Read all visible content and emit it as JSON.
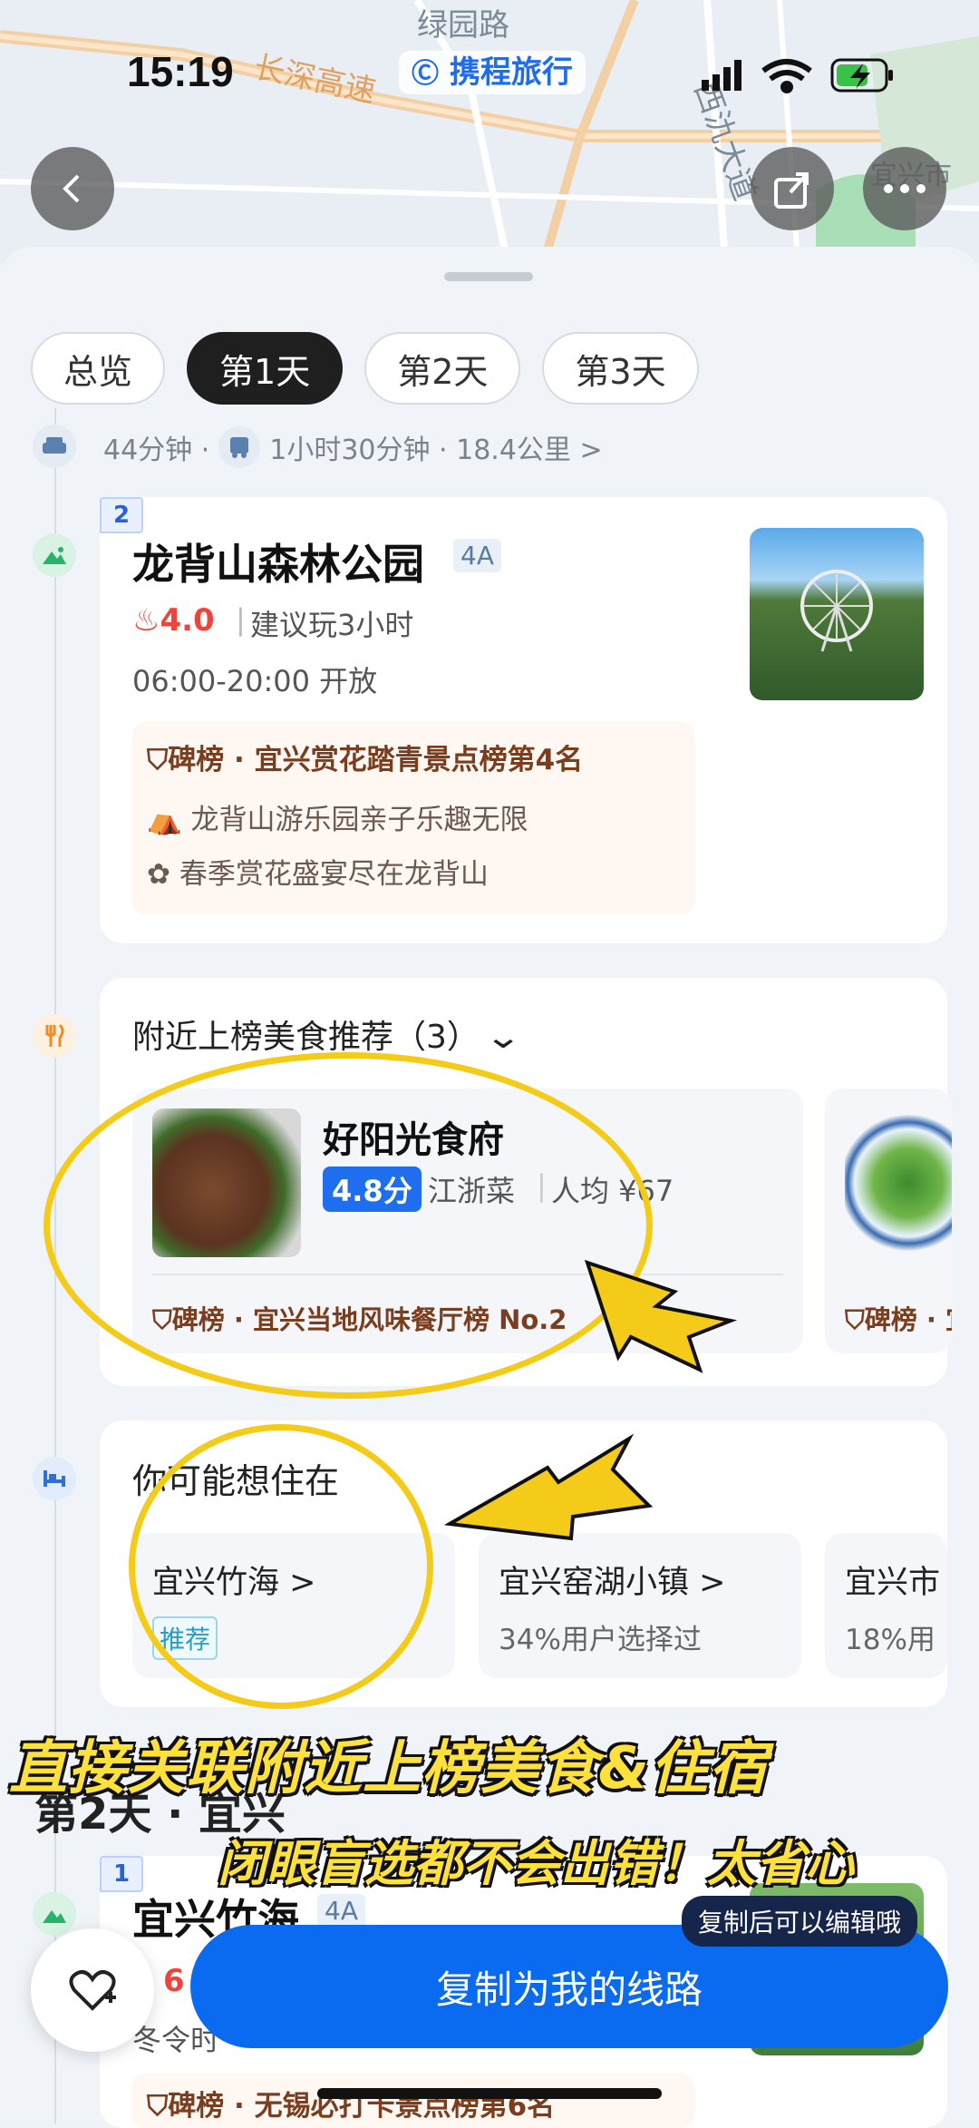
{
  "status_bar": {
    "time": "15:19",
    "brand": "携程旅行"
  },
  "map": {
    "labels": [
      "绿园路",
      "长深高速",
      "西氿大道",
      "宜兴市"
    ]
  },
  "tabs": [
    "总览",
    "第1天",
    "第2天",
    "第3天"
  ],
  "active_tab": "第1天",
  "route": {
    "drive": "44分钟 ·",
    "bus": "1小时30分钟 · 18.4公里 >"
  },
  "poi1": {
    "index": "2",
    "name": "龙背山森林公园",
    "grade": "4A",
    "rating": "4.0",
    "suggest": "建议玩3小时",
    "hours": "06:00-20:00 开放",
    "rank": "碑榜 · 宜兴赏花踏青景点榜第4名",
    "highlights": [
      "龙背山游乐园亲子乐趣无限",
      "春季赏花盛宴尽在龙背山"
    ]
  },
  "food": {
    "title": "附近上榜美食推荐（3）",
    "item": {
      "name": "好阳光食府",
      "score": "4.8分",
      "cuisine": "江浙菜",
      "price": "人均 ¥67",
      "rank": "碑榜 · 宜兴当地风味餐厅榜 No.2"
    },
    "next_rank": "碑榜 · 宜"
  },
  "hotels": {
    "title": "你可能想住在",
    "items": [
      {
        "name": "宜兴竹海 >",
        "tag": "推荐"
      },
      {
        "name": "宜兴窑湖小镇 >",
        "sub": "34%用户选择过"
      },
      {
        "name": "宜兴市",
        "sub": "18%用"
      }
    ]
  },
  "day2": {
    "heading": "第2天 · 宜兴",
    "index": "1",
    "name": "宜兴竹海",
    "grade": "4A",
    "rating": "6",
    "hours": "冬令时",
    "rank": "碑榜 · 无锡必打卡景点榜第6名"
  },
  "overlay": {
    "caption1": "直接关联附近上榜美食&住宿",
    "caption2": "闭眼盲选都不会出错！太省心"
  },
  "bottom": {
    "copy": "复制为我的线路",
    "tip": "复制后可以编辑哦"
  },
  "colors": {
    "accent": "#0a6bf0",
    "highlight": "#f5cb1a",
    "rank": "#7a3e1e"
  }
}
